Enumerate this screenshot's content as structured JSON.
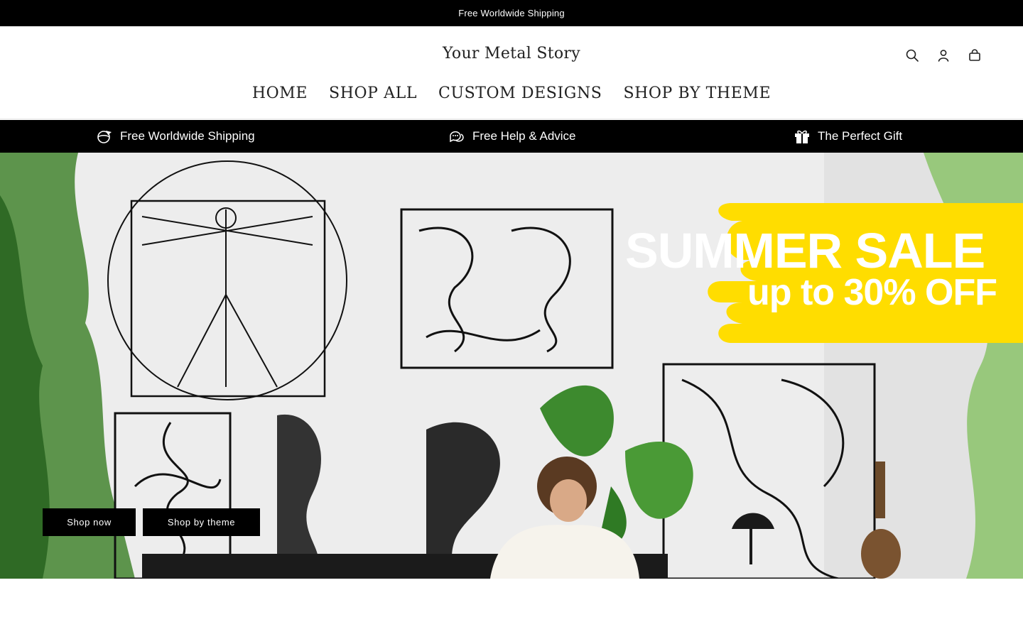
{
  "announcement": {
    "text": "Free Worldwide Shipping"
  },
  "header": {
    "logo": "Your Metal Story",
    "icons": [
      "search-icon",
      "account-icon",
      "cart-icon"
    ],
    "nav": [
      "HOME",
      "SHOP ALL",
      "CUSTOM DESIGNS",
      "SHOP BY THEME"
    ]
  },
  "usp": {
    "items": [
      {
        "label": "Free Worldwide Shipping",
        "icon": "globe-plane-icon"
      },
      {
        "label": "Free Help & Advice",
        "icon": "chat-bubbles-icon"
      },
      {
        "label": "The Perfect Gift",
        "icon": "gift-icon"
      }
    ]
  },
  "hero": {
    "sale_title": "SUMMER SALE",
    "sale_subtitle": "up to 30% OFF",
    "accent_color": "#ffdd00",
    "buttons": {
      "shop_now": "Shop now",
      "shop_by_theme": "Shop by theme"
    }
  }
}
